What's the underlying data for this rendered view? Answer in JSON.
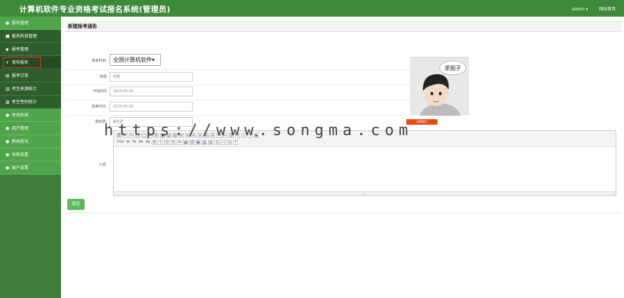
{
  "app": {
    "title": "计算机软件专业资格考试报名系统(管理员)",
    "user": "admin ▾",
    "site_home": "网站首页"
  },
  "sidebar": {
    "items": [
      {
        "label": "报名管理",
        "icon": "●",
        "type": "group"
      },
      {
        "label": "报名科目管理",
        "icon": "■",
        "type": "sub"
      },
      {
        "label": "报考管理",
        "icon": "◆",
        "type": "sub"
      },
      {
        "label": "发布报名",
        "icon": "+",
        "type": "sub-active"
      },
      {
        "label": "报考订单",
        "icon": "▤",
        "type": "sub"
      },
      {
        "label": "考生来源统计",
        "icon": "▥",
        "type": "sub"
      },
      {
        "label": "考生性别统计",
        "icon": "▧",
        "type": "sub"
      },
      {
        "label": "考场安排",
        "icon": "●",
        "type": "group"
      },
      {
        "label": "用户管理",
        "icon": "●",
        "type": "group"
      },
      {
        "label": "新闻资讯",
        "icon": "●",
        "type": "group"
      },
      {
        "label": "系统设置",
        "icon": "●",
        "type": "group"
      },
      {
        "label": "账户设置",
        "icon": "●",
        "type": "group"
      }
    ]
  },
  "panel": {
    "title": "新建报考通告"
  },
  "form": {
    "subject_label": "报考科目:",
    "subject_value": "全国计算机软件▾",
    "title_label": "标题",
    "title_value": "标题",
    "start_label": "开始时间",
    "start_value": "2019-05-29",
    "end_label": "结束时间:",
    "end_value": "2019-05-29",
    "fee_label": "报名费:",
    "fee_value": "报名费",
    "desc_label": "介绍:",
    "pick_image": "选择图片",
    "avatar_bubble": "求图子",
    "submit": "提交"
  },
  "editor": {
    "row1": [
      "源",
      "↶",
      "↷",
      "▢",
      "▢",
      "✂",
      "⎘",
      "▣",
      "▤",
      "▥",
      "≡",
      "≡",
      "≡",
      "≡",
      "☰",
      "☰",
      "⇥",
      "⇤",
      "Ω",
      "✎",
      "⌕",
      "✓",
      "▣"
    ],
    "row2_text": [
      "H1▾",
      "ƒ▾",
      "T▾",
      "A▾",
      "A▾"
    ],
    "row2": [
      "B",
      "I",
      "U",
      "S",
      "⌗",
      "▦",
      "☺",
      "▣",
      "▤",
      "▥",
      "⚓",
      "—",
      "⇲",
      "?"
    ],
    "resize": "⇕"
  },
  "watermark": "https://www.songma.com"
}
